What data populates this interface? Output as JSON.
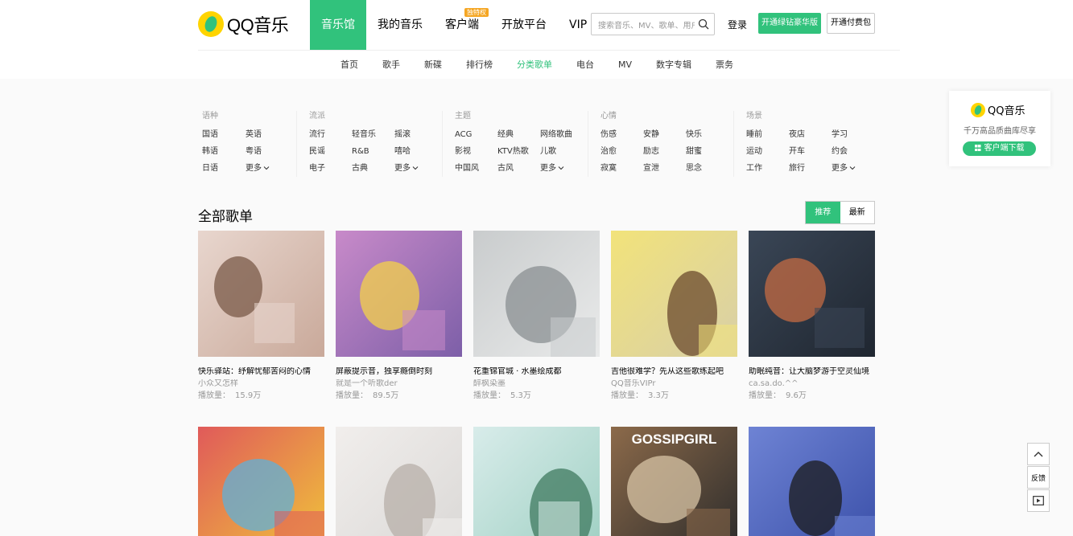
{
  "brand": {
    "name": "QQ音乐"
  },
  "mainnav": [
    {
      "label": "音乐馆",
      "active": true
    },
    {
      "label": "我的音乐"
    },
    {
      "label": "客户端",
      "badge": "独特权"
    },
    {
      "label": "开放平台"
    },
    {
      "label": "VIP"
    }
  ],
  "search": {
    "placeholder": "搜索音乐、MV、歌单、用户"
  },
  "header": {
    "login": "登录",
    "green_btn": "开通绿钻豪华版",
    "outline_btn": "开通付费包"
  },
  "subnav": [
    "首页",
    "歌手",
    "新碟",
    "排行榜",
    "分类歌单",
    "电台",
    "MV",
    "数字专辑",
    "票务"
  ],
  "subnav_active": "分类歌单",
  "filters": [
    {
      "title": "语种",
      "items": [
        "国语",
        "英语",
        "韩语",
        "粤语",
        "日语",
        "更多"
      ],
      "cols": 2
    },
    {
      "title": "流派",
      "items": [
        "流行",
        "轻音乐",
        "摇滚",
        "民谣",
        "R&B",
        "嘻哈",
        "电子",
        "古典",
        "更多"
      ],
      "cols": 3
    },
    {
      "title": "主题",
      "items": [
        "ACG",
        "经典",
        "网络歌曲",
        "影视",
        "KTV热歌",
        "儿歌",
        "中国风",
        "古风",
        "更多"
      ],
      "cols": 3
    },
    {
      "title": "心情",
      "items": [
        "伤感",
        "安静",
        "快乐",
        "治愈",
        "励志",
        "甜蜜",
        "寂寞",
        "宣泄",
        "思念"
      ],
      "cols": 3
    },
    {
      "title": "场景",
      "items": [
        "睡前",
        "夜店",
        "学习",
        "运动",
        "开车",
        "约会",
        "工作",
        "旅行",
        "更多"
      ],
      "cols": 3
    }
  ],
  "sidecard": {
    "name": "QQ音乐",
    "desc": "千万高品质曲库尽享",
    "btn": "客户端下载"
  },
  "section": {
    "title": "全部歌单",
    "sort": [
      "推荐",
      "最新"
    ]
  },
  "play_label": "播放量：",
  "playlists": [
    {
      "title": "快乐驿站：纾解忧郁苦闷的心情",
      "author": "小众又怎样",
      "plays": "15.9万",
      "palette": [
        "#c9a99a",
        "#7a5a48",
        "#e8d6ce"
      ]
    },
    {
      "title": "屏蔽提示音，独享瘾倒时刻",
      "author": "就是一个听歌der",
      "plays": "89.5万",
      "palette": [
        "#7d5fa8",
        "#f4d24a",
        "#c88ac9"
      ]
    },
    {
      "title": "花重锦官城 · 水墨绘成都",
      "author": "醉枫染墨",
      "plays": "5.3万",
      "palette": [
        "#e9eaea",
        "#8a8f92",
        "#c9cccd"
      ]
    },
    {
      "title": "吉他很难学？先从这些歌练起吧",
      "author": "QQ音乐VIPr",
      "plays": "3.3万",
      "palette": [
        "#d8cfa8",
        "#6b4a2e",
        "#f2e37a"
      ]
    },
    {
      "title": "助眠纯音：让大脑梦游于空灵仙境",
      "author": "ca.sa.do.^^",
      "plays": "9.6万",
      "palette": [
        "#1f2630",
        "#c46b43",
        "#3a4656"
      ]
    },
    {
      "title": "",
      "author": "",
      "plays": "",
      "palette": [
        "#f0c43a",
        "#5fb0d8",
        "#e05a5a"
      ]
    },
    {
      "title": "",
      "author": "",
      "plays": "",
      "palette": [
        "#dad8d6",
        "#b7afa8",
        "#f1eeec"
      ]
    },
    {
      "title": "",
      "author": "",
      "plays": "",
      "palette": [
        "#9fd0c3",
        "#3f7a5f",
        "#d8ecea"
      ]
    },
    {
      "title": "",
      "author": "",
      "plays": "",
      "palette": [
        "#2b2b2b",
        "#d8c4a6",
        "#8c6a4a"
      ],
      "overlay_text": "GOSSIPGIRL"
    },
    {
      "title": "",
      "author": "",
      "plays": "",
      "palette": [
        "#3a4fa8",
        "#1b1b1b",
        "#6e83d4"
      ]
    }
  ],
  "float_tools": {
    "feedback": "反馈"
  }
}
